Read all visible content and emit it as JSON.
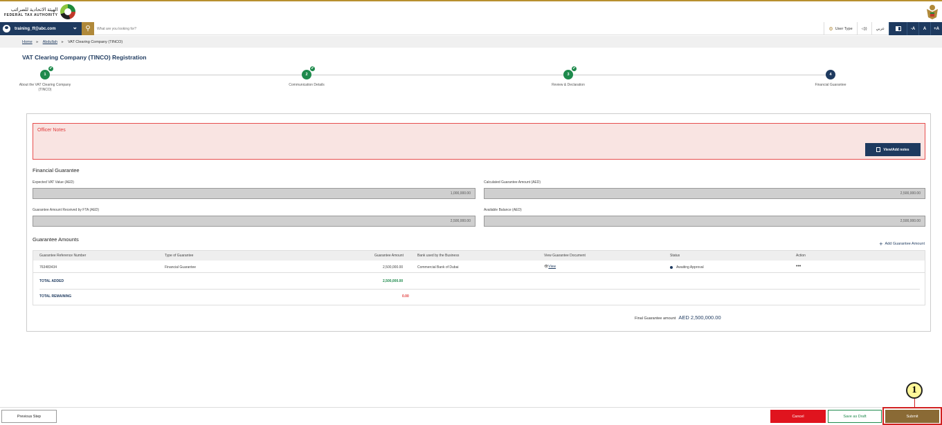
{
  "header": {
    "logo_ar": "الهيئة الاتحادية للضرائب",
    "logo_en": "FEDERAL TAX AUTHORITY"
  },
  "navbar": {
    "user_email": "training_ff@abc.com",
    "search_placeholder": "What are you looking for?",
    "user_type": "User Type",
    "speaker": "◁))",
    "language": "عربي",
    "font_minus": "-A",
    "font_normal": "A",
    "font_plus": "+A"
  },
  "breadcrumb": {
    "home": "Home",
    "user": "Abdullah",
    "current": "VAT Clearing Company (TINCO)",
    "separator": "►"
  },
  "page": {
    "title": "VAT Clearing Company (TINCO) Registration"
  },
  "stepper": {
    "steps": [
      {
        "number": "1",
        "label": "About the VAT Clearing Company (TINCO)",
        "status": "done"
      },
      {
        "number": "2",
        "label": "Communication Details",
        "status": "done"
      },
      {
        "number": "3",
        "label": "Review & Declaration",
        "status": "done"
      },
      {
        "number": "4",
        "label": "Financial Guarantee",
        "status": "current"
      }
    ],
    "check": "✔"
  },
  "officer_notes": {
    "title": "Officer Notes",
    "button": "View/Add notes"
  },
  "financial_guarantee": {
    "title": "Financial Guarantee",
    "expected_vat_label": "Expected VAT Value (AED)",
    "expected_vat_value": "1,000,000.00",
    "calculated_label": "Calculated Guarantee Amount (AED)",
    "calculated_value": "2,500,000.00",
    "received_label": "Guarantee Amount Received by FTA (AED)",
    "received_value": "2,500,000.00",
    "available_label": "Available Balance (AED)",
    "available_value": "2,500,000.00"
  },
  "guarantee_amounts": {
    "title": "Guarantee Amounts",
    "add_link": "Add Guarantee Amount",
    "headers": {
      "ref": "Guarantee Reference Number",
      "type": "Type of Guarantee",
      "amount": "Guarantee Amount",
      "bank": "Bank used by the Business",
      "doc": "View Guarantee Document",
      "status": "Status",
      "action": "Action"
    },
    "rows": [
      {
        "ref": "763483434",
        "type": "Financial Guarantee",
        "amount": "2,500,000.00",
        "bank": "Commercial Bank of Dubai",
        "doc": "View",
        "status": "Awaiting Approval",
        "action": "•••"
      }
    ],
    "total_added_label": "TOTAL ADDED",
    "total_added_value": "2,500,000.00",
    "total_remaining_label": "TOTAL REMAINING",
    "total_remaining_value": "0.00"
  },
  "final_guarantee": {
    "label": "Final Guarantee amount",
    "value": "AED  2,500,000.00"
  },
  "footer": {
    "previous": "Previous Step",
    "cancel": "Cancel",
    "save_draft": "Save as Draft",
    "submit": "Submit"
  },
  "annotation": {
    "callout_number": "1"
  },
  "colors": {
    "navy": "#1e3a5f",
    "gold": "#b0893a",
    "green": "#1e8a4c",
    "red": "#e0141e",
    "submit": "#8a6a35"
  }
}
